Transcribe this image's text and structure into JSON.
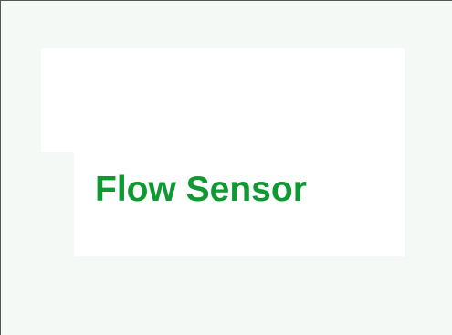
{
  "slide": {
    "title": "Flow Sensor"
  },
  "colors": {
    "title_text": "#0f9933",
    "background": "#f5f9f5",
    "panel": "#ffffff"
  }
}
